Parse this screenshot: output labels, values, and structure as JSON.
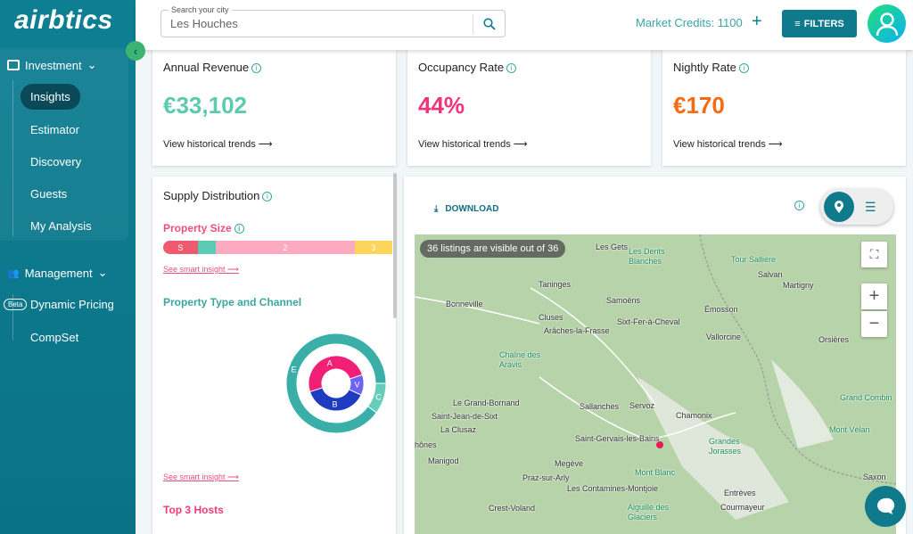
{
  "sidebar": {
    "logo": "airbtics",
    "investment": "Investment",
    "items": [
      {
        "label": "Insights"
      },
      {
        "label": "Estimator"
      },
      {
        "label": "Discovery"
      },
      {
        "label": "Guests"
      },
      {
        "label": "My Analysis"
      }
    ],
    "management": "Management",
    "beta": "Beta",
    "mgmt_items": [
      {
        "label": "Dynamic Pricing"
      },
      {
        "label": "CompSet"
      }
    ]
  },
  "header": {
    "search_label": "Search your city",
    "search_value": "Les Houches",
    "credits": "Market Credits: 1100",
    "add": "+",
    "filters": "FILTERS"
  },
  "metrics": [
    {
      "title": "Annual Revenue",
      "value": "€33,102",
      "link": "View historical trends ⟶",
      "color": "#5ccbad"
    },
    {
      "title": "Occupancy Rate",
      "value": "44%",
      "link": "View historical trends ⟶",
      "color": "#f0337a"
    },
    {
      "title": "Nightly Rate",
      "value": "€170",
      "link": "View historical trends ⟶",
      "color": "#f76a12"
    }
  ],
  "supply": {
    "title": "Supply Distribution",
    "property_size": "Property Size",
    "size_segments": [
      {
        "label": "S",
        "share": 23,
        "color": "#ef5a6f"
      },
      {
        "label": "",
        "share": 12,
        "color": "#5ccbb4"
      },
      {
        "label": "2",
        "share": 92,
        "color": "#fbaabf"
      },
      {
        "label": "3",
        "share": 25,
        "color": "#fdd45c"
      }
    ],
    "smart_insight": "See smart insight ⟶",
    "property_type": "Property Type and Channel",
    "inner_ring": [
      {
        "label": "A",
        "share": 50,
        "color": "#f21f77"
      },
      {
        "label": "V",
        "share": 12,
        "color": "#6b63f5"
      },
      {
        "label": "B",
        "share": 38,
        "color": "#1f3bc0"
      }
    ],
    "outer_ring": [
      {
        "label": "C",
        "share": 10,
        "color": "#66cdb8"
      },
      {
        "label": "E",
        "share": 90,
        "color": "#39afa7"
      }
    ],
    "smart_insight2": "See smart insight ⟶",
    "top_hosts": "Top 3 Hosts"
  },
  "map": {
    "download": "DOWNLOAD",
    "visible": "36 listings are visible out of 36",
    "zoom_in": "+",
    "zoom_out": "−",
    "labels": [
      "Les Gets",
      "Les Dents Blanches",
      "Tour Sallière",
      "Salvan",
      "Taninges",
      "Martigny",
      "Samoëns",
      "Bonneville",
      "Émosson",
      "Cluses",
      "Sixt-Fer-à-Cheval",
      "Arâches-la-Frasse",
      "Vallorcine",
      "Orsières",
      "Chaîne des Aravis",
      "Le Grand-Bornand",
      "Servoz",
      "Sallanches",
      "Grand Combin",
      "Saint-Jean-de-Sixt",
      "Chamonix",
      "La Clusaz",
      "Mont Vélan",
      "Saint-Gervais-les-Bains",
      "Grandes Jorasses",
      "hônes",
      "Manigod",
      "Megève",
      "Mont Blanc",
      "Saxon",
      "Praz-sur-Arly",
      "Les Contamines-Montjoie",
      "Entrèves",
      "Crest-Voland",
      "Aiguille des Glaciers",
      "Courmayeur"
    ]
  }
}
